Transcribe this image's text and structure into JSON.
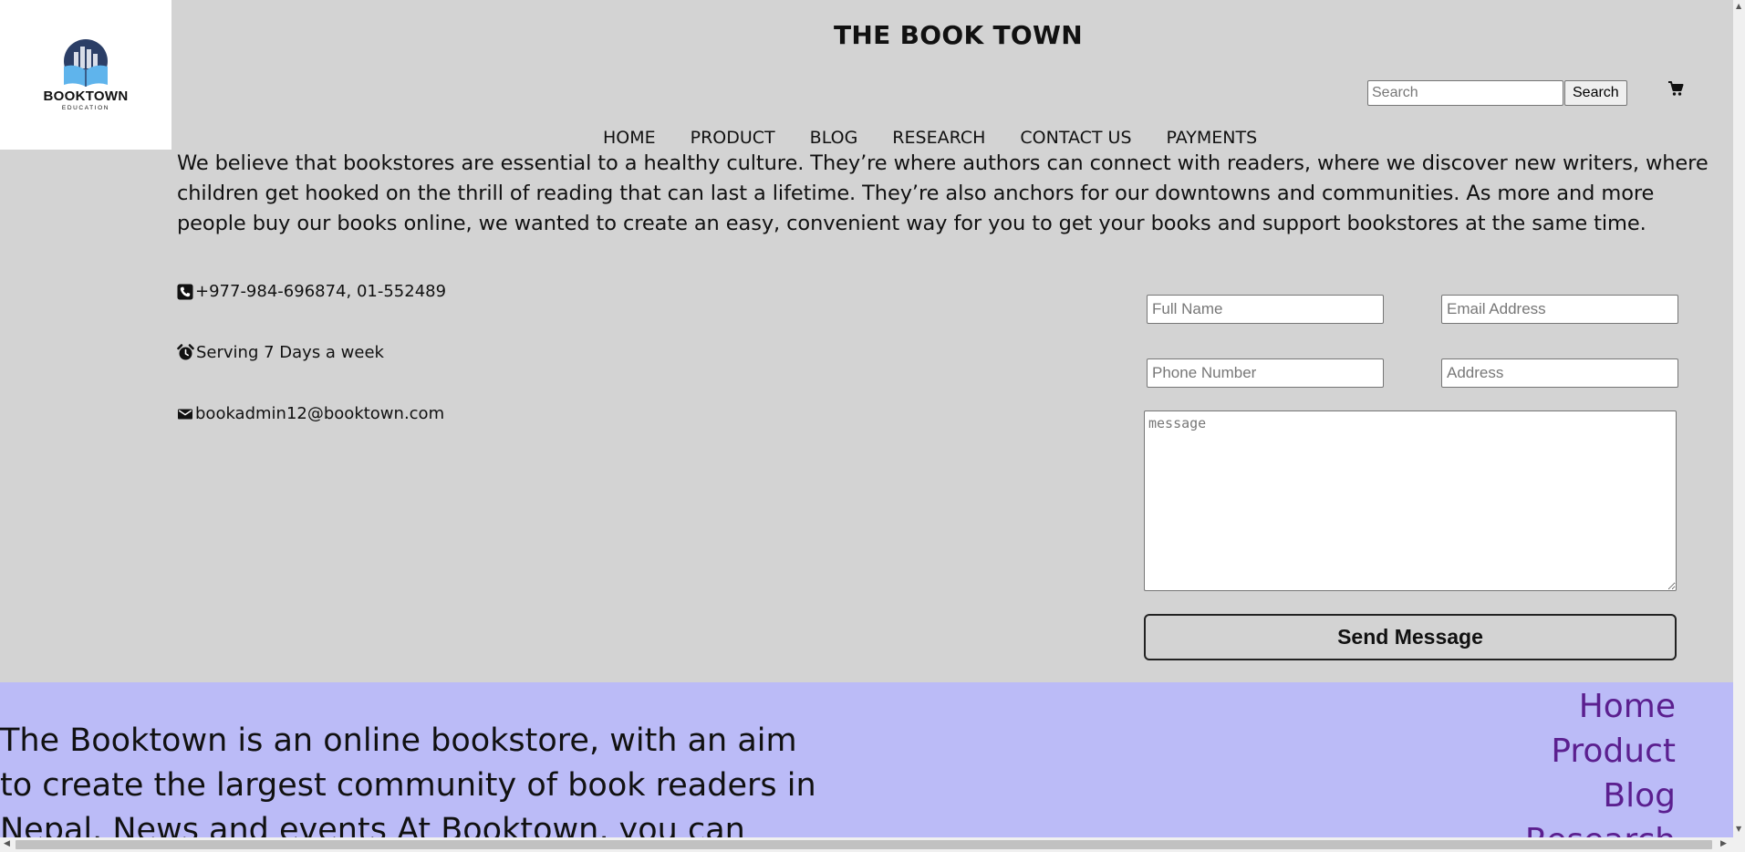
{
  "brand": {
    "logo_text": "BOOKTOWN",
    "logo_subtext": "EDUCATION",
    "site_title": "THE BOOK TOWN"
  },
  "search": {
    "placeholder": "Search",
    "button_label": "Search"
  },
  "header": {
    "cart_icon": "cart-icon"
  },
  "nav": {
    "items": [
      "HOME",
      "PRODUCT",
      "BLOG",
      "RESEARCH",
      "CONTACT US",
      "PAYMENTS"
    ]
  },
  "intro": {
    "text": "We believe that bookstores are essential to a healthy culture. They’re where authors can connect with readers, where we discover new writers, where children get hooked on the thrill of reading that can last a lifetime. They’re also anchors for our downtowns and communities. As more and more people buy our books online, we wanted to create an easy, convenient way for you to get your books and support bookstores at the same time."
  },
  "contact": {
    "phone": "+977-984-696874, 01-552489",
    "hours": "Serving 7 Days a week",
    "email": "bookadmin12@booktown.com"
  },
  "form": {
    "full_name_placeholder": "Full Name",
    "email_placeholder": "Email Address",
    "phone_placeholder": "Phone Number",
    "address_placeholder": "Address",
    "message_placeholder": "message",
    "submit_label": "Send Message"
  },
  "footer": {
    "about": "The Booktown is an online bookstore, with an aim to create the largest community of book readers in Nepal. News and events At Booktown, you can",
    "links": [
      "Home",
      "Product",
      "Blog",
      "Research"
    ]
  },
  "colors": {
    "page_bg": "#d3d3d3",
    "footer_bg": "#bbbbf7",
    "footer_link": "#5b1f8f"
  }
}
